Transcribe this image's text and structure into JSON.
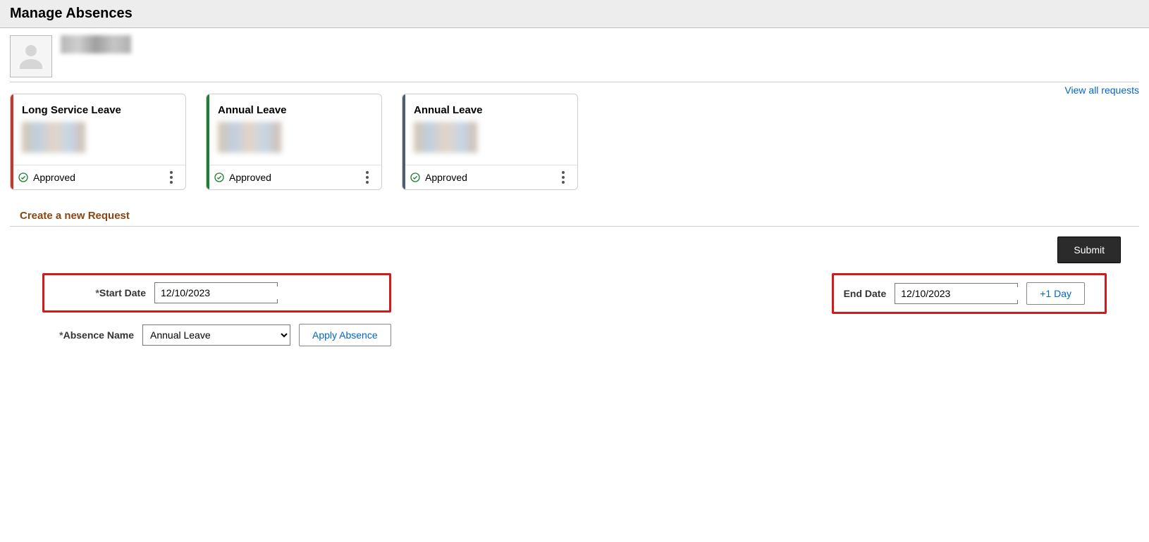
{
  "header": {
    "title": "Manage Absences"
  },
  "viewAllLabel": "View all requests",
  "cards": [
    {
      "title": "Long Service Leave",
      "status": "Approved",
      "stripe": "red"
    },
    {
      "title": "Annual Leave",
      "status": "Approved",
      "stripe": "green"
    },
    {
      "title": "Annual Leave",
      "status": "Approved",
      "stripe": "slate"
    }
  ],
  "sectionHeading": "Create a new Request",
  "submitLabel": "Submit",
  "form": {
    "startDateLabel": "Start Date",
    "startDateValue": "12/10/2023",
    "absenceNameLabel": "Absence Name",
    "absenceNameValue": "Annual Leave",
    "applyAbsenceLabel": "Apply Absence",
    "endDateLabel": "End Date",
    "endDateValue": "12/10/2023",
    "plusOneDayLabel": "+1 Day"
  }
}
